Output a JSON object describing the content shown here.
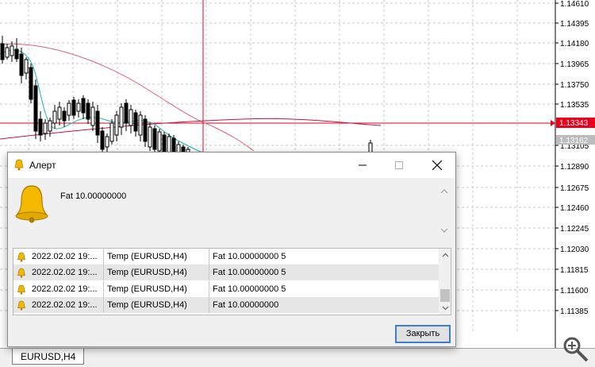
{
  "chart": {
    "price_scale": [
      "1.14610",
      "1.14395",
      "1.14180",
      "1.13965",
      "1.13750",
      "1.13535",
      "1.13162",
      "1.13105",
      "1.12890",
      "1.12675",
      "1.12460",
      "1.12245",
      "1.12030",
      "1.11815",
      "1.11600",
      "1.11385"
    ],
    "current_price": "1.13343",
    "current_price_color": "#e8001c",
    "last_price": "1.13162"
  },
  "dialog": {
    "title": "Алерт",
    "message": "Fat 10.00000000",
    "alerts": [
      {
        "time": "2022.02.02 19:...",
        "expert": "Temp (EURUSD,H4)",
        "message": "Fat 10.00000000 5"
      },
      {
        "time": "2022.02.02 19:...",
        "expert": "Temp (EURUSD,H4)",
        "message": "Fat 10.00000000 5"
      },
      {
        "time": "2022.02.02 19:...",
        "expert": "Temp (EURUSD,H4)",
        "message": "Fat 10.00000000 5"
      },
      {
        "time": "2022.02.02 19:...",
        "expert": "Temp (EURUSD,H4)",
        "message": "Fat 10.00000000"
      }
    ],
    "close_label": "Закрыть"
  },
  "tabs": [
    {
      "label": "EURUSD,H4"
    }
  ],
  "icons": {
    "title": "bell-icon",
    "message": "large-bell-icon",
    "row": "bell-icon",
    "zoom": "zoom-in-icon"
  },
  "colors": {
    "bell": "#f5b800",
    "accent": "#3c7fd1"
  }
}
